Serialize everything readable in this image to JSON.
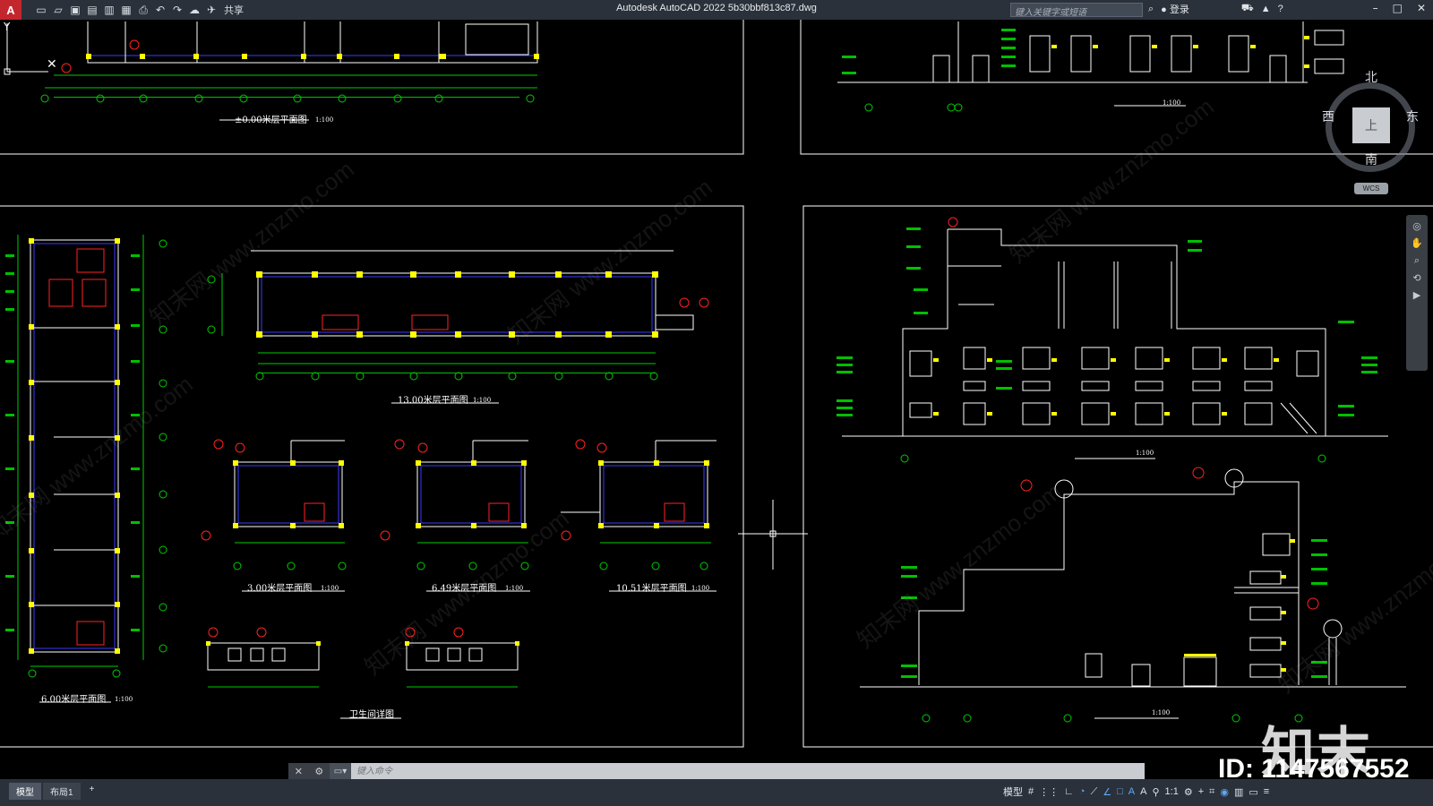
{
  "titlebar": {
    "app_letter": "A",
    "share_label": "共享",
    "title": "Autodesk AutoCAD 2022    5b30bbf813c87.dwg",
    "search_placeholder": "键入关键字或短语",
    "login_label": "登录",
    "help_label": "?"
  },
  "viewcube": {
    "north": "北",
    "south": "南",
    "west": "西",
    "east": "东",
    "face": "上",
    "wcs": "WCS"
  },
  "drawing": {
    "labels": {
      "plan_000": "±0.00米层平面图",
      "plan_1300": "13.00米层平面图",
      "plan_300": "3.00米层平面图",
      "plan_649": "6.49米层平面图",
      "plan_1051": "10.51米层平面图",
      "plan_600": "6.00米层平面图",
      "toilet_detail": "卫生间详图",
      "scale": "1:100"
    },
    "watermark": "知末网 www.znzmo.com",
    "colors": {
      "wall": "#ffffff",
      "dim": "#00c000",
      "column": "#ffff00",
      "note": "#ff2020",
      "window": "#3a3aff"
    }
  },
  "command": {
    "placeholder": "键入命令"
  },
  "statusbar": {
    "tab_model": "模型",
    "tab_layout1": "布局1",
    "add_tab": "+",
    "model_label": "模型",
    "scale_label": "1:1"
  },
  "brand": {
    "logo_text": "知末",
    "id_text": "ID: 1147567552"
  }
}
